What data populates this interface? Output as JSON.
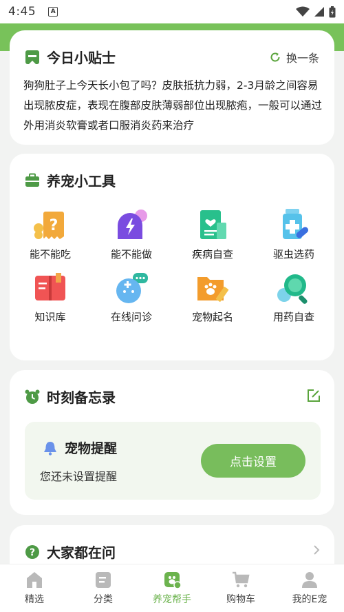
{
  "status_bar": {
    "time": "4:45",
    "app_badge": "A"
  },
  "tip": {
    "title": "今日小贴士",
    "refresh_label": "换一条",
    "text": "狗狗肚子上今天长小包了吗？皮肤抵抗力弱，2-3月龄之间容易出现脓皮症，表现在腹部皮肤薄弱部位出现脓疱，一般可以通过外用消炎软膏或者口服消炎药来治疗"
  },
  "tools": {
    "title": "养宠小工具",
    "items": [
      {
        "label": "能不能吃",
        "icon": "food-question-icon"
      },
      {
        "label": "能不能做",
        "icon": "activity-lightning-icon"
      },
      {
        "label": "疾病自查",
        "icon": "health-record-icon"
      },
      {
        "label": "驱虫选药",
        "icon": "medicine-bottle-icon"
      },
      {
        "label": "知识库",
        "icon": "book-icon"
      },
      {
        "label": "在线问诊",
        "icon": "online-consult-icon"
      },
      {
        "label": "宠物起名",
        "icon": "paw-folder-icon"
      },
      {
        "label": "用药自查",
        "icon": "magnifier-icon"
      }
    ]
  },
  "memo": {
    "title": "时刻备忘录",
    "reminder_title": "宠物提醒",
    "reminder_status": "您还未设置提醒",
    "button_label": "点击设置"
  },
  "ask": {
    "title": "大家都在问"
  },
  "bottom_nav": {
    "items": [
      {
        "label": "精选",
        "icon": "home-icon",
        "active": false
      },
      {
        "label": "分类",
        "icon": "category-icon",
        "active": false
      },
      {
        "label": "养宠帮手",
        "icon": "pet-helper-icon",
        "active": true
      },
      {
        "label": "购物车",
        "icon": "cart-icon",
        "active": false
      },
      {
        "label": "我的E宠",
        "icon": "profile-icon",
        "active": false
      }
    ]
  },
  "colors": {
    "accent": "#78c25a",
    "button": "#78bd5c",
    "active_nav": "#6cb34e"
  }
}
